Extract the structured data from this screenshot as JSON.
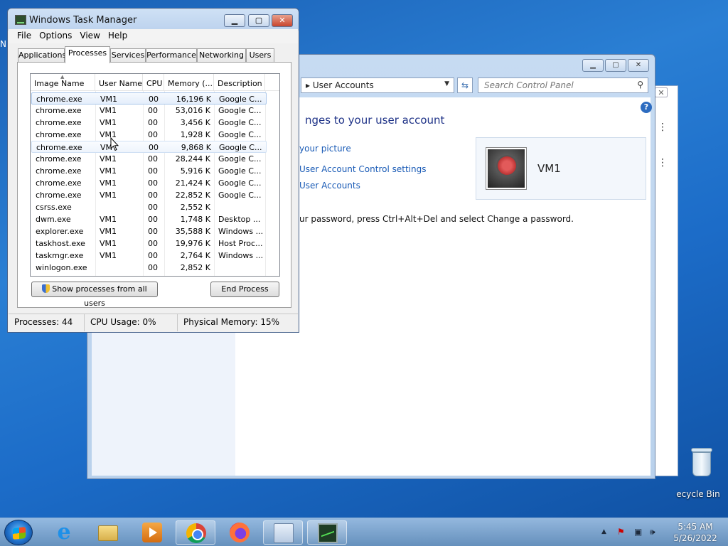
{
  "desktop": {
    "edge_text": "N",
    "recycle_bin_label": "ecycle Bin"
  },
  "control_panel": {
    "breadcrumb": "User Accounts",
    "search_placeholder": "Search Control Panel",
    "heading": "nges to your user account",
    "links": [
      "your picture",
      "User Account Control settings",
      "User Accounts"
    ],
    "password_text": "ur password, press Ctrl+Alt+Del and select Change a password.",
    "user_name": "VM1",
    "help_glyph": "?"
  },
  "task_manager": {
    "title": "Windows Task Manager",
    "menu": [
      "File",
      "Options",
      "View",
      "Help"
    ],
    "tabs": [
      "Applications",
      "Processes",
      "Services",
      "Performance",
      "Networking",
      "Users"
    ],
    "active_tab": "Processes",
    "columns": [
      "Image Name",
      "User Name",
      "CPU",
      "Memory (...",
      "Description"
    ],
    "rows": [
      {
        "name": "chrome.exe",
        "user": "VM1",
        "cpu": "00",
        "mem": "16,196 K",
        "desc": "Google C..."
      },
      {
        "name": "chrome.exe",
        "user": "VM1",
        "cpu": "00",
        "mem": "53,016 K",
        "desc": "Google C..."
      },
      {
        "name": "chrome.exe",
        "user": "VM1",
        "cpu": "00",
        "mem": "3,456 K",
        "desc": "Google C..."
      },
      {
        "name": "chrome.exe",
        "user": "VM1",
        "cpu": "00",
        "mem": "1,928 K",
        "desc": "Google C..."
      },
      {
        "name": "chrome.exe",
        "user": "VM",
        "cpu": "00",
        "mem": "9,868 K",
        "desc": "Google C..."
      },
      {
        "name": "chrome.exe",
        "user": "VM1",
        "cpu": "00",
        "mem": "28,244 K",
        "desc": "Google C..."
      },
      {
        "name": "chrome.exe",
        "user": "VM1",
        "cpu": "00",
        "mem": "5,916 K",
        "desc": "Google C..."
      },
      {
        "name": "chrome.exe",
        "user": "VM1",
        "cpu": "00",
        "mem": "21,424 K",
        "desc": "Google C..."
      },
      {
        "name": "chrome.exe",
        "user": "VM1",
        "cpu": "00",
        "mem": "22,852 K",
        "desc": "Google C..."
      },
      {
        "name": "csrss.exe",
        "user": "",
        "cpu": "00",
        "mem": "2,552 K",
        "desc": ""
      },
      {
        "name": "dwm.exe",
        "user": "VM1",
        "cpu": "00",
        "mem": "1,748 K",
        "desc": "Desktop ..."
      },
      {
        "name": "explorer.exe",
        "user": "VM1",
        "cpu": "00",
        "mem": "35,588 K",
        "desc": "Windows ..."
      },
      {
        "name": "taskhost.exe",
        "user": "VM1",
        "cpu": "00",
        "mem": "19,976 K",
        "desc": "Host Proc..."
      },
      {
        "name": "taskmgr.exe",
        "user": "VM1",
        "cpu": "00",
        "mem": "2,764 K",
        "desc": "Windows ..."
      },
      {
        "name": "winlogon.exe",
        "user": "",
        "cpu": "00",
        "mem": "2,852 K",
        "desc": ""
      }
    ],
    "show_all_label": "Show processes from all users",
    "end_process_label": "End Process",
    "status": {
      "processes": "Processes: 44",
      "cpu": "CPU Usage: 0%",
      "memory": "Physical Memory: 15%"
    }
  },
  "taskbar": {
    "items": [
      "start-button",
      "internet-explorer",
      "windows-explorer",
      "media-player",
      "google-chrome",
      "firefox",
      "control-panel",
      "task-manager"
    ],
    "clock_time": "5:45 AM",
    "clock_date": "5/26/2022",
    "tray_arrow": "▲"
  },
  "colors": {
    "desktop": "#1c6cc8",
    "link": "#1a5bb6",
    "heading": "#1e3287",
    "close_button": "#c8452e"
  }
}
